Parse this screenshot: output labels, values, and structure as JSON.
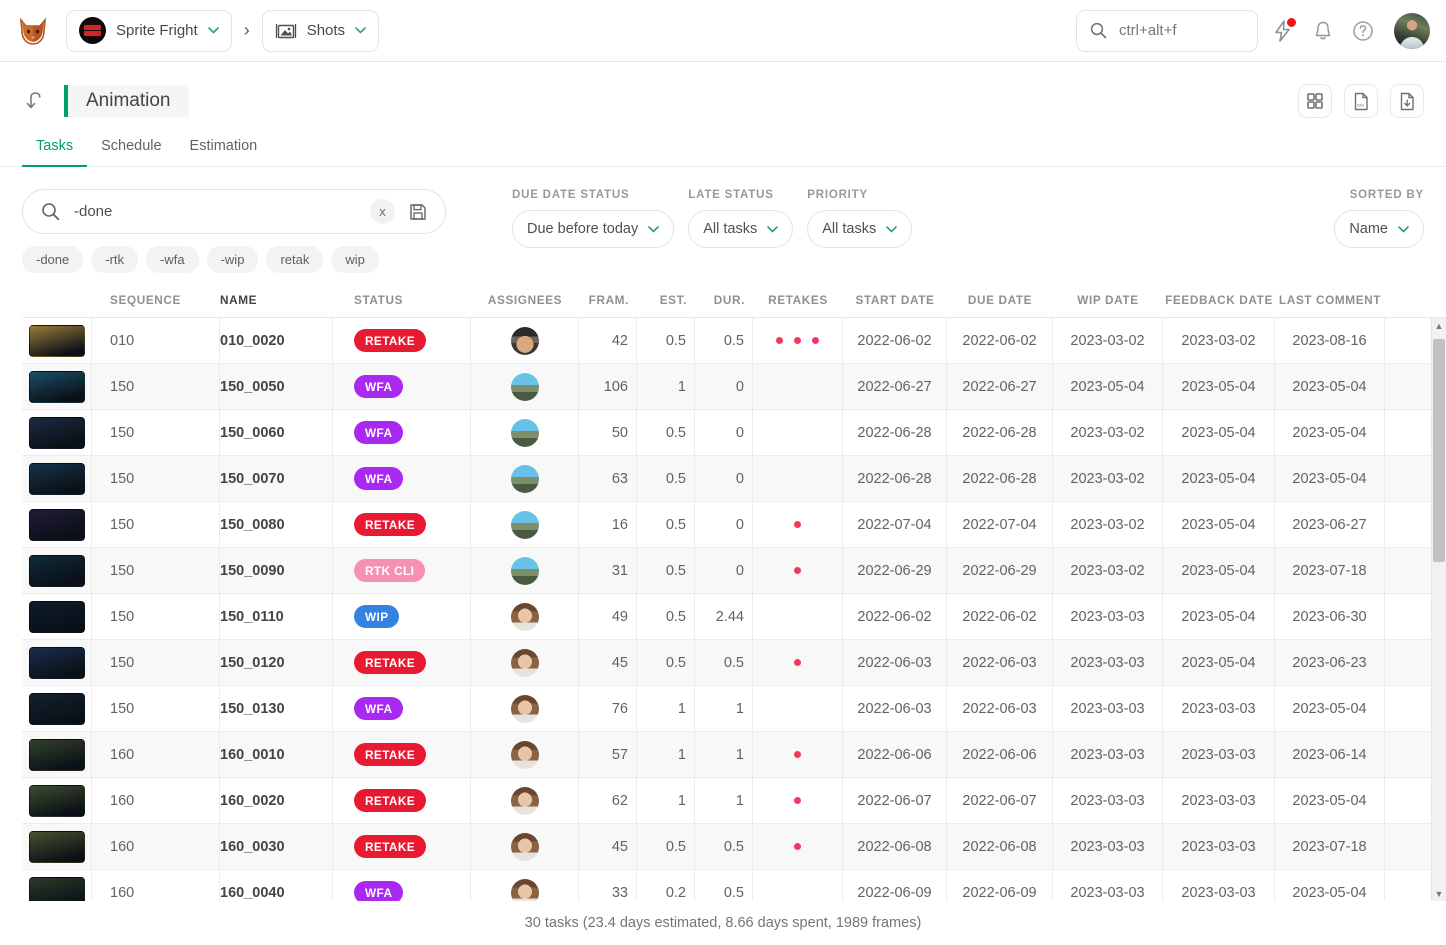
{
  "topbar": {
    "logo_icon": "fox-logo-icon",
    "project_name": "Sprite Fright",
    "breadcrumb_separator": "›",
    "section_name": "Shots",
    "search_placeholder": "ctrl+alt+f",
    "search_value": "",
    "search_icon": "search-icon",
    "shots_icon": "clapperboard-icon",
    "flash_icon": "lightning-icon",
    "bell_icon": "bell-icon",
    "help_icon": "question-circle-icon",
    "avatar_icon": "user-avatar"
  },
  "header": {
    "back_icon": "back-arrow-icon",
    "title": "Animation",
    "accent_color": "#00a06d",
    "actions": [
      {
        "name": "grid-view-button",
        "icon": "grid-icon"
      },
      {
        "name": "import-csv-button",
        "icon": "csv-file-icon"
      },
      {
        "name": "export-button",
        "icon": "download-file-icon"
      }
    ]
  },
  "tabs": [
    {
      "label": "Tasks",
      "active": true
    },
    {
      "label": "Schedule",
      "active": false
    },
    {
      "label": "Estimation",
      "active": false
    }
  ],
  "search": {
    "value": "-done",
    "placeholder": "",
    "clear_label": "x",
    "save_icon": "save-disk-icon",
    "chips": [
      "-done",
      "-rtk",
      "-wfa",
      "-wip",
      "retak",
      "wip"
    ]
  },
  "filters": [
    {
      "label": "DUE DATE STATUS",
      "value": "Due before today",
      "name": "due-date-status-select"
    },
    {
      "label": "LATE STATUS",
      "value": "All tasks",
      "name": "late-status-select"
    },
    {
      "label": "PRIORITY",
      "value": "All tasks",
      "name": "priority-select"
    }
  ],
  "sort": {
    "label": "SORTED BY",
    "value": "Name"
  },
  "table": {
    "columns": [
      "SEQUENCE",
      "NAME",
      "STATUS",
      "ASSIGNEES",
      "FRAM.",
      "EST.",
      "DUR.",
      "RETAKES",
      "START DATE",
      "DUE DATE",
      "WIP DATE",
      "FEEDBACK DATE",
      "LAST COMMENT"
    ],
    "status_colors": {
      "RETAKE": "#e81a32",
      "WFA": "#aa29f2",
      "RTK CLI": "#f791b4",
      "WIP": "#3583e1"
    },
    "rows": [
      {
        "seq": "010",
        "name": "010_0020",
        "status": "RETAKE",
        "assignee": "beard",
        "fram": "42",
        "est": "0.5",
        "dur": "0.5",
        "retakes": 3,
        "start": "2022-06-02",
        "due": "2022-06-02",
        "wip": "2023-03-02",
        "feedback": "2023-03-02",
        "last": "2023-08-16",
        "thumb": "#9a7b3a"
      },
      {
        "seq": "150",
        "name": "150_0050",
        "status": "WFA",
        "assignee": "mountain",
        "fram": "106",
        "est": "1",
        "dur": "0",
        "retakes": 0,
        "start": "2022-06-27",
        "due": "2022-06-27",
        "wip": "2023-05-04",
        "feedback": "2023-05-04",
        "last": "2023-05-04",
        "thumb": "#1c4d66"
      },
      {
        "seq": "150",
        "name": "150_0060",
        "status": "WFA",
        "assignee": "mountain",
        "fram": "50",
        "est": "0.5",
        "dur": "0",
        "retakes": 0,
        "start": "2022-06-28",
        "due": "2022-06-28",
        "wip": "2023-03-02",
        "feedback": "2023-05-04",
        "last": "2023-05-04",
        "thumb": "#1b2a42"
      },
      {
        "seq": "150",
        "name": "150_0070",
        "status": "WFA",
        "assignee": "mountain",
        "fram": "63",
        "est": "0.5",
        "dur": "0",
        "retakes": 0,
        "start": "2022-06-28",
        "due": "2022-06-28",
        "wip": "2023-03-02",
        "feedback": "2023-05-04",
        "last": "2023-05-04",
        "thumb": "#15334a"
      },
      {
        "seq": "150",
        "name": "150_0080",
        "status": "RETAKE",
        "assignee": "mountain",
        "fram": "16",
        "est": "0.5",
        "dur": "0",
        "retakes": 1,
        "start": "2022-07-04",
        "due": "2022-07-04",
        "wip": "2023-03-02",
        "feedback": "2023-05-04",
        "last": "2023-06-27",
        "thumb": "#221a38"
      },
      {
        "seq": "150",
        "name": "150_0090",
        "status": "RTK CLI",
        "assignee": "mountain",
        "fram": "31",
        "est": "0.5",
        "dur": "0",
        "retakes": 1,
        "start": "2022-06-29",
        "due": "2022-06-29",
        "wip": "2023-03-02",
        "feedback": "2023-05-04",
        "last": "2023-07-18",
        "thumb": "#102a38"
      },
      {
        "seq": "150",
        "name": "150_0110",
        "status": "WIP",
        "assignee": "girl",
        "fram": "49",
        "est": "0.5",
        "dur": "2.44",
        "retakes": 0,
        "start": "2022-06-02",
        "due": "2022-06-02",
        "wip": "2023-03-03",
        "feedback": "2023-05-04",
        "last": "2023-06-30",
        "thumb": "#0d1c2c"
      },
      {
        "seq": "150",
        "name": "150_0120",
        "status": "RETAKE",
        "assignee": "girl",
        "fram": "45",
        "est": "0.5",
        "dur": "0.5",
        "retakes": 1,
        "start": "2022-06-03",
        "due": "2022-06-03",
        "wip": "2023-03-03",
        "feedback": "2023-05-04",
        "last": "2023-06-23",
        "thumb": "#1a2d4d"
      },
      {
        "seq": "150",
        "name": "150_0130",
        "status": "WFA",
        "assignee": "girl",
        "fram": "76",
        "est": "1",
        "dur": "1",
        "retakes": 0,
        "start": "2022-06-03",
        "due": "2022-06-03",
        "wip": "2023-03-03",
        "feedback": "2023-03-03",
        "last": "2023-05-04",
        "thumb": "#13202e"
      },
      {
        "seq": "160",
        "name": "160_0010",
        "status": "RETAKE",
        "assignee": "girl",
        "fram": "57",
        "est": "1",
        "dur": "1",
        "retakes": 1,
        "start": "2022-06-06",
        "due": "2022-06-06",
        "wip": "2023-03-03",
        "feedback": "2023-03-03",
        "last": "2023-06-14",
        "thumb": "#32402c"
      },
      {
        "seq": "160",
        "name": "160_0020",
        "status": "RETAKE",
        "assignee": "girl",
        "fram": "62",
        "est": "1",
        "dur": "1",
        "retakes": 1,
        "start": "2022-06-07",
        "due": "2022-06-07",
        "wip": "2023-03-03",
        "feedback": "2023-03-03",
        "last": "2023-05-04",
        "thumb": "#3d4b30"
      },
      {
        "seq": "160",
        "name": "160_0030",
        "status": "RETAKE",
        "assignee": "girl",
        "fram": "45",
        "est": "0.5",
        "dur": "0.5",
        "retakes": 1,
        "start": "2022-06-08",
        "due": "2022-06-08",
        "wip": "2023-03-03",
        "feedback": "2023-03-03",
        "last": "2023-07-18",
        "thumb": "#46522f"
      },
      {
        "seq": "160",
        "name": "160_0040",
        "status": "WFA",
        "assignee": "girl",
        "fram": "33",
        "est": "0.2",
        "dur": "0.5",
        "retakes": 0,
        "start": "2022-06-09",
        "due": "2022-06-09",
        "wip": "2023-03-03",
        "feedback": "2023-03-03",
        "last": "2023-05-04",
        "thumb": "#2c3a28"
      }
    ]
  },
  "footer": {
    "summary": "30 tasks (23.4 days estimated, 8.66 days spent, 1989 frames)"
  },
  "scrollbar": {
    "up_arrow": "▲",
    "down_arrow": "▼"
  }
}
